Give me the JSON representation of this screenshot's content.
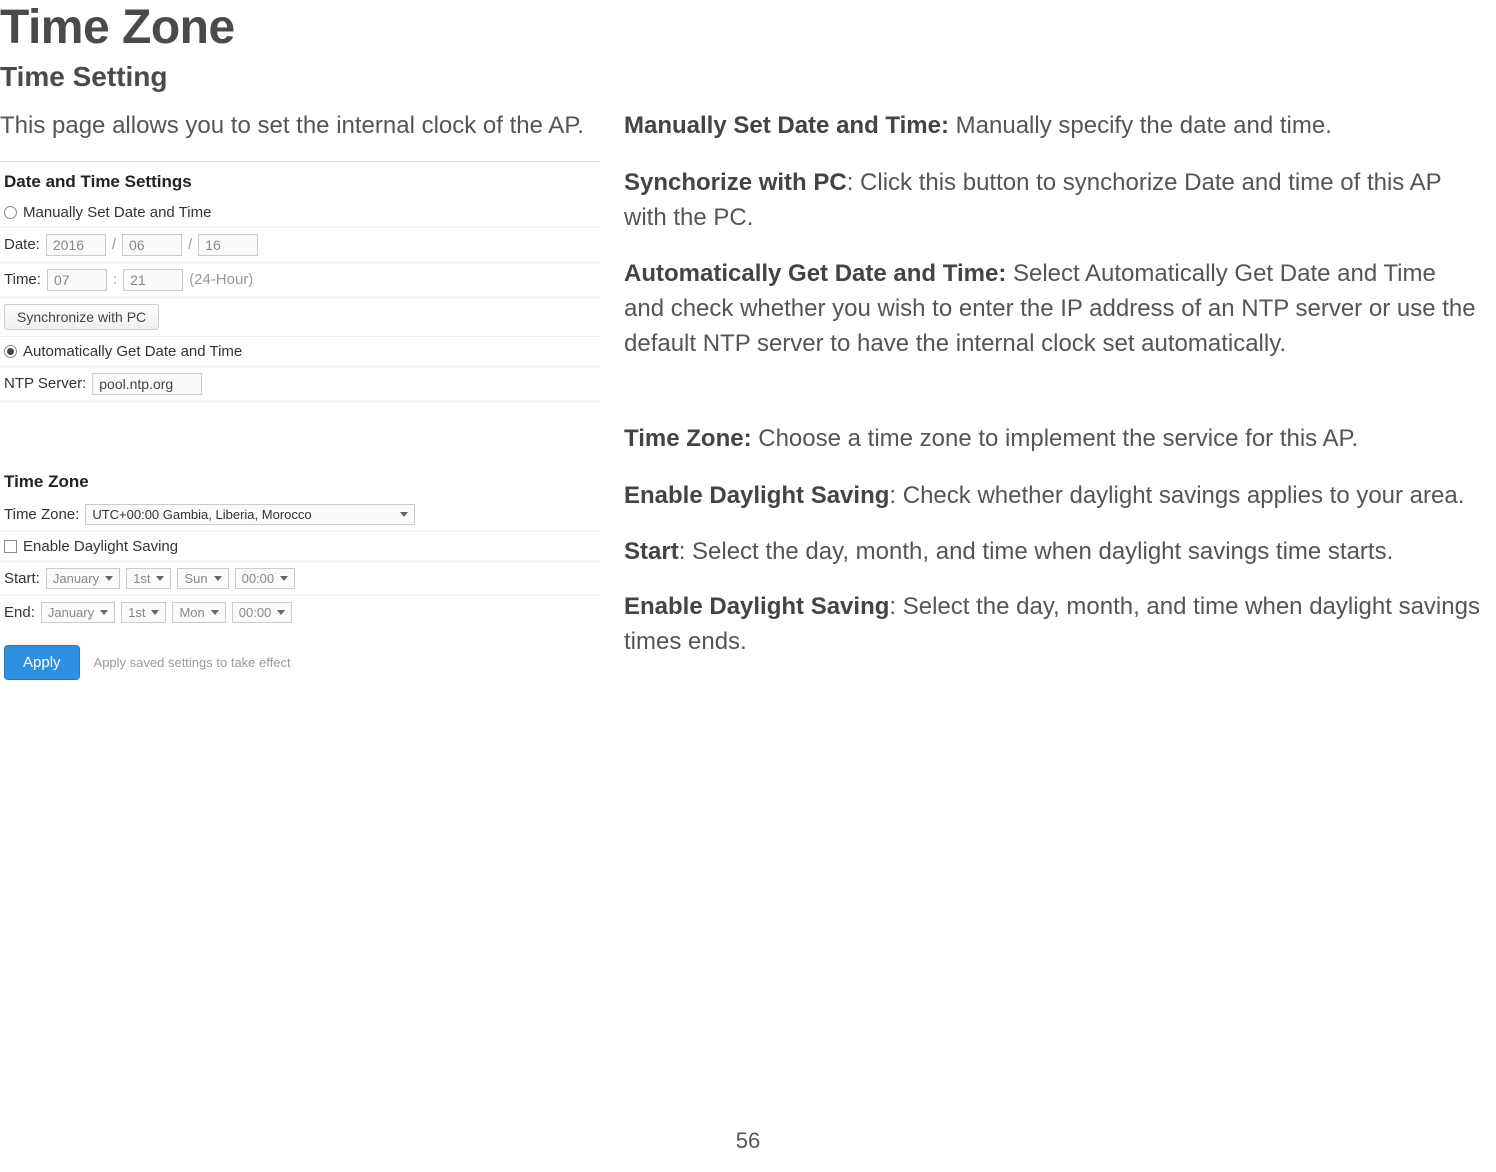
{
  "page_number": "56",
  "title": "Time Zone",
  "subtitle": "Time Setting",
  "intro": "This page allows you to set the internal clock of the AP.",
  "panel": {
    "date_time_header": "Date and Time Settings",
    "manual_label": "Manually Set Date and Time",
    "date_label": "Date:",
    "date_year": "2016",
    "date_month": "06",
    "date_day": "16",
    "slash": "/",
    "time_label": "Time:",
    "time_hour": "07",
    "time_min": "21",
    "time_colon": ":",
    "time_format": "(24-Hour)",
    "sync_btn": "Synchronize with PC",
    "auto_label": "Automatically Get Date and Time",
    "ntp_label": "NTP Server:",
    "ntp_value": "pool.ntp.org",
    "tz_header": "Time Zone",
    "tz_label": "Time Zone:",
    "tz_value": "UTC+00:00 Gambia, Liberia, Morocco",
    "dst_enable": "Enable Daylight Saving",
    "start_label": "Start:",
    "end_label": "End:",
    "month_jan": "January",
    "ord_1st": "1st",
    "day_sun": "Sun",
    "day_mon": "Mon",
    "time_0000": "00:00",
    "apply_btn": "Apply",
    "apply_note": "Apply saved settings to take effect"
  },
  "desc": {
    "p1_b": "Manually Set Date and Time:",
    "p1_t": " Manually specify the date and time.",
    "p2_b": "Synchorize with PC",
    "p2_t": ": Click this button to synchorize Date and time of this AP with the PC.",
    "p3_b": "Automatically Get Date and Time:",
    "p3_t": " Select Automatically Get Date and Time and check whether you wish to enter the IP address of an NTP server or use the default NTP server to have the internal clock set automatically.",
    "p4_b": "Time Zone:",
    "p4_t": " Choose a time zone to implement the service for this AP.",
    "p5_b": "Enable Daylight Saving",
    "p5_t": ": Check whether daylight savings applies to your area.",
    "p6_b": "Start",
    "p6_t": ": Select the day, month, and time when daylight savings time starts.",
    "p7_b": "Enable Daylight Saving",
    "p7_t": ": Select the day, month, and time when daylight savings times ends."
  }
}
